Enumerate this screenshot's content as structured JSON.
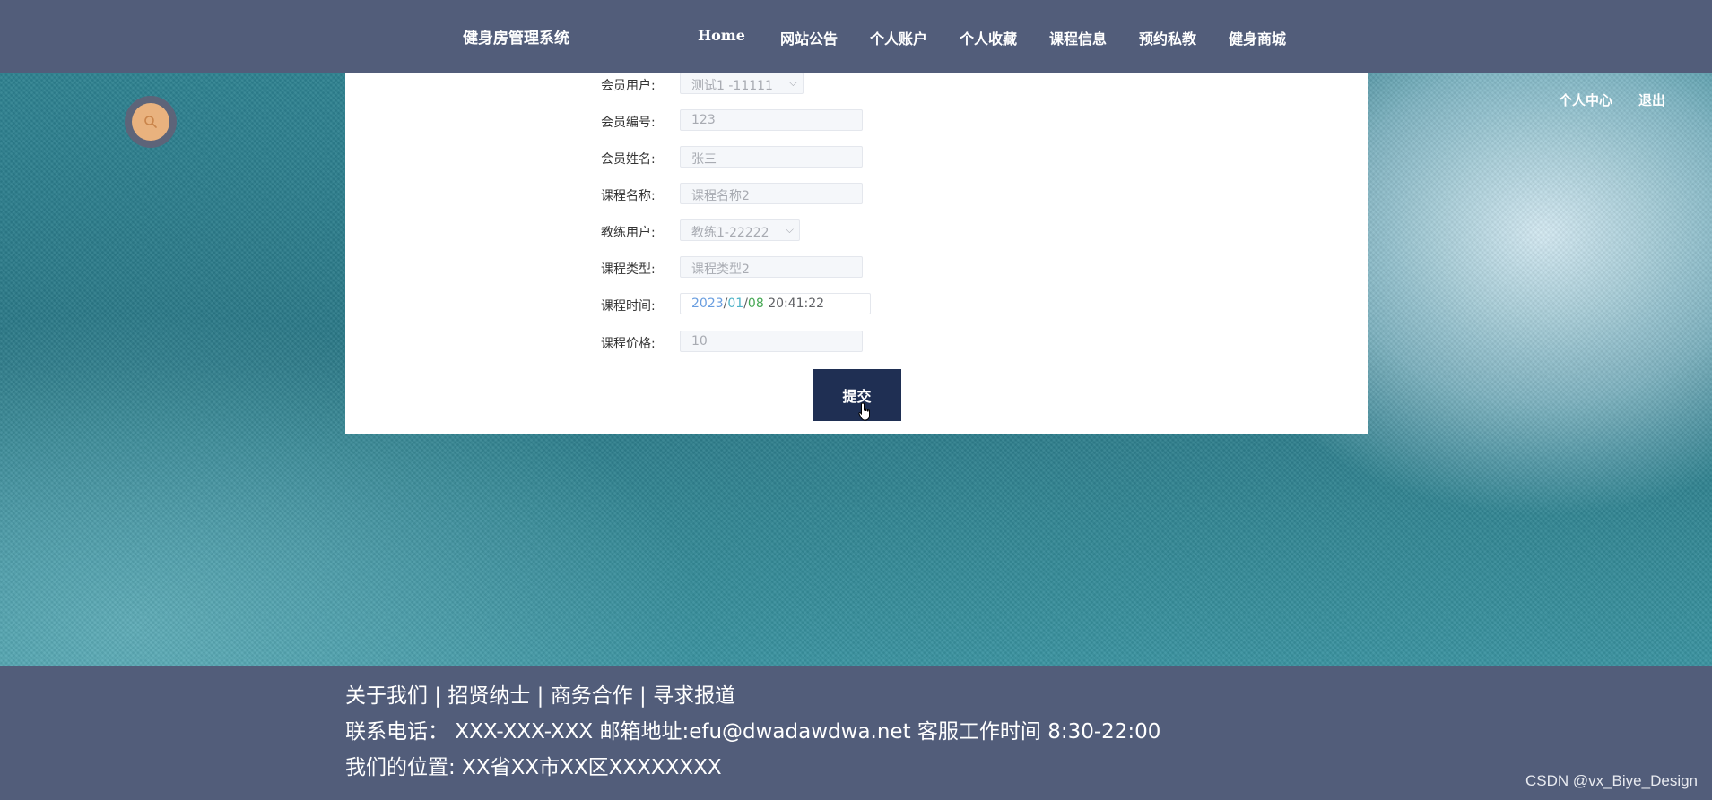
{
  "header": {
    "brand": "健身房管理系统",
    "nav": [
      "Home",
      "网站公告",
      "个人账户",
      "个人收藏",
      "课程信息",
      "预约私教",
      "健身商城"
    ]
  },
  "user_links": {
    "center": "个人中心",
    "logout": "退出"
  },
  "search": {
    "icon": "search-icon"
  },
  "form": {
    "fields": [
      {
        "label": "会员用户:",
        "value": "测试1 -11111",
        "type": "select"
      },
      {
        "label": "会员编号:",
        "value": "123",
        "type": "input"
      },
      {
        "label": "会员姓名:",
        "value": "张三",
        "type": "input"
      },
      {
        "label": "课程名称:",
        "value": "课程名称2",
        "type": "input"
      },
      {
        "label": "教练用户:",
        "value": "教练1-22222",
        "type": "select"
      },
      {
        "label": "课程类型:",
        "value": "课程类型2",
        "type": "input"
      },
      {
        "label": "课程时间:",
        "type": "datetime",
        "year": "2023",
        "sep1": "/",
        "month": "01",
        "sep2": "/",
        "day": "08",
        "time": "20:41:22"
      },
      {
        "label": "课程价格:",
        "value": "10",
        "type": "input"
      }
    ],
    "submit": "提交"
  },
  "footer": {
    "line1": "关于我们 | 招贤纳士 | 商务合作 | 寻求报道",
    "line2": "联系电话：  XXX-XXX-XXX 邮箱地址:efu@dwadawdwa.net 客服工作时间 8:30-22:00",
    "line3": "我们的位置: XX省XX市XX区XXXXXXXX"
  },
  "watermark": "CSDN @vx_Biye_Design",
  "colors": {
    "header_bg": "#525d7a",
    "submit_bg": "#1f2f53",
    "search_accent": "#e9b27e"
  }
}
